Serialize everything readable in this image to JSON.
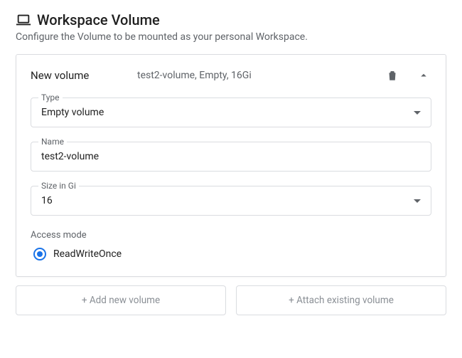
{
  "header": {
    "title": "Workspace Volume",
    "subtitle": "Configure the Volume to be mounted as your personal Workspace."
  },
  "volume": {
    "label": "New volume",
    "summary": "test2-volume, Empty, 16Gi",
    "type": {
      "label": "Type",
      "value": "Empty volume"
    },
    "name": {
      "label": "Name",
      "value": "test2-volume"
    },
    "size": {
      "label": "Size in Gi",
      "value": "16"
    },
    "access": {
      "label": "Access mode",
      "options": [
        {
          "label": "ReadWriteOnce",
          "selected": true
        }
      ]
    }
  },
  "buttons": {
    "add": "+ Add new volume",
    "attach": "+ Attach existing volume"
  }
}
